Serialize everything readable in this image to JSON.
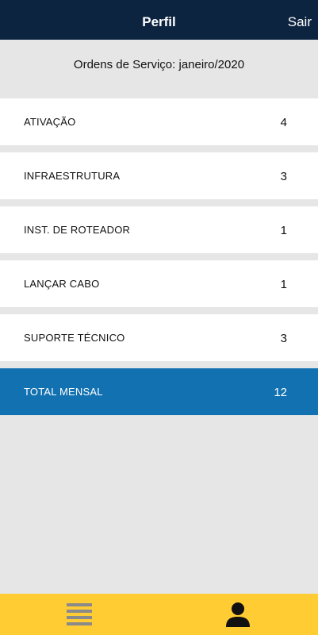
{
  "header": {
    "title": "Perfil",
    "logout_label": "Sair"
  },
  "subtitle": "Ordens de Serviço: janeiro/2020",
  "rows": [
    {
      "label": "ATIVAÇÃO",
      "count": "4"
    },
    {
      "label": "INFRAESTRUTURA",
      "count": "3"
    },
    {
      "label": "INST. DE ROTEADOR",
      "count": "1"
    },
    {
      "label": "LANÇAR CABO",
      "count": "1"
    },
    {
      "label": "SUPORTE TÉCNICO",
      "count": "3"
    }
  ],
  "total": {
    "label": "TOTAL MENSAL",
    "count": "12"
  },
  "tabbar": {
    "menu_icon": "list-icon",
    "profile_icon": "person-icon"
  },
  "colors": {
    "header_bg": "#0d2440",
    "total_bg": "#1271b1",
    "tabbar_bg": "#ffcc33",
    "page_bg": "#e6e6e6"
  }
}
